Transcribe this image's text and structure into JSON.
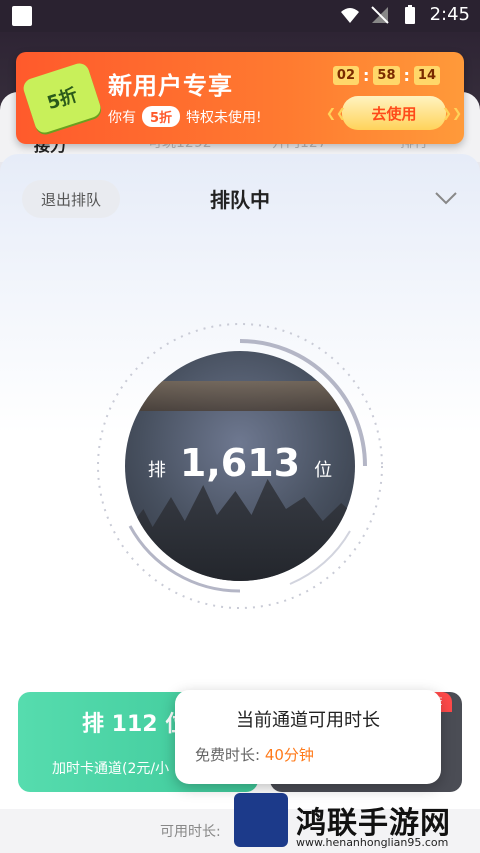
{
  "status_bar": {
    "time": "2:45"
  },
  "background_tabs": [
    "接力",
    "可玩1292",
    "开门127",
    "排行"
  ],
  "banner": {
    "badge": "5折",
    "title": "新用户专享",
    "sub_prefix": "你有",
    "sub_pill": "5折",
    "sub_suffix": "特权未使用!",
    "timer": [
      "02",
      "58",
      "14"
    ],
    "button_label": "去使用"
  },
  "queue": {
    "exit_label": "退出排队",
    "title": "排队中",
    "rank_prefix": "排",
    "rank_number": "1,613",
    "rank_suffix": "位"
  },
  "cards": {
    "green_rank": "排 112 位",
    "green_label": "加时卡通道(2元/小",
    "recommend_tag": "荐"
  },
  "tooltip": {
    "title": "当前通道可用时长",
    "free_label": "免费时长:",
    "free_value": "40分钟"
  },
  "bottom": {
    "available_label": "可用时长:"
  },
  "watermark": {
    "name": "鸿联手游网",
    "url": "www.henanhonglian95.com"
  },
  "colors": {
    "accent_orange": "#ff5a2c",
    "green": "#3fc99a"
  }
}
